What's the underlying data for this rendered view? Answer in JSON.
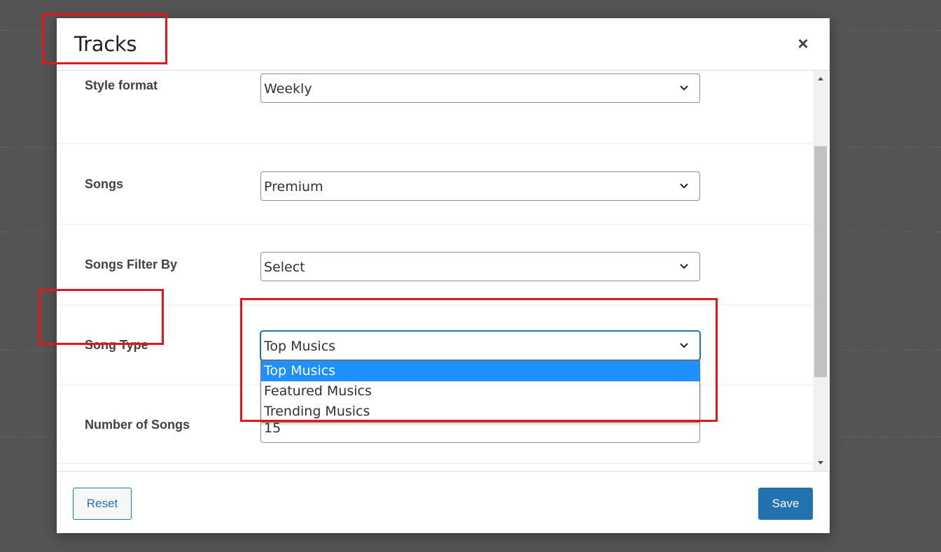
{
  "modal": {
    "title": "Tracks",
    "close_label": "×"
  },
  "fields": {
    "style_format": {
      "label": "Style format",
      "value": "Weekly"
    },
    "songs": {
      "label": "Songs",
      "value": "Premium"
    },
    "songs_filter_by": {
      "label": "Songs Filter By",
      "value": "Select"
    },
    "song_type": {
      "label": "Song Type",
      "value": "Top Musics",
      "options": [
        "Top Musics",
        "Featured Musics",
        "Trending Musics"
      ],
      "highlighted_option": "Top Musics"
    },
    "number_of_songs": {
      "label": "Number of Songs",
      "value": "15"
    }
  },
  "footer": {
    "reset_label": "Reset",
    "save_label": "Save"
  },
  "colors": {
    "accent": "#2271b1",
    "highlight": "#1e90ff",
    "annotation": "#e8141b",
    "overlay": "#545454"
  },
  "icons": {
    "select_arrow": "chevron-down-icon",
    "close": "close-icon",
    "scroll_up": "arrow-up-icon",
    "scroll_down": "arrow-down-icon"
  }
}
